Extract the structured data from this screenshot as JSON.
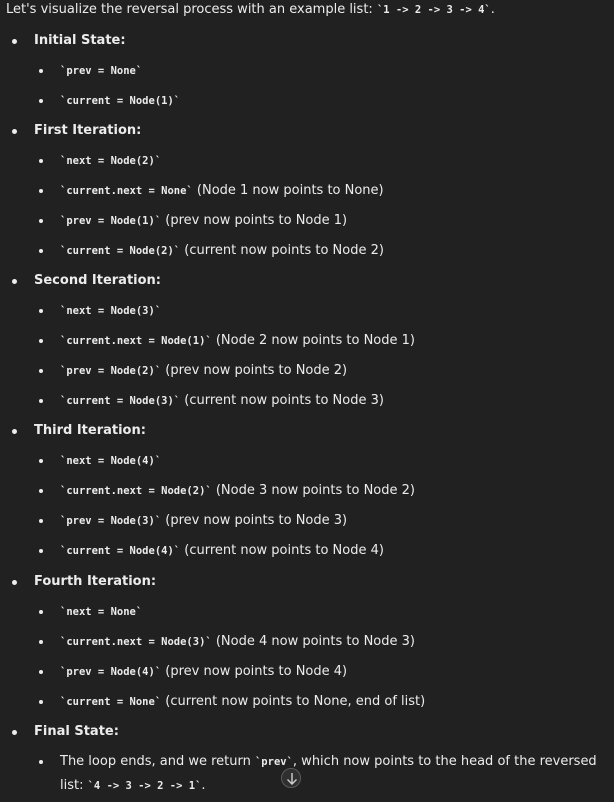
{
  "intro": {
    "prefix": "Let's visualize the reversal process with an example list: ",
    "code": "`1 -> 2 -> 3 -> 4`",
    "suffix": "."
  },
  "sections": [
    {
      "heading": "Initial State:",
      "items": [
        {
          "code": "`prev = None`",
          "text": ""
        },
        {
          "code": "`current = Node(1)`",
          "text": ""
        }
      ]
    },
    {
      "heading": "First Iteration:",
      "items": [
        {
          "code": "`next = Node(2)`",
          "text": ""
        },
        {
          "code": "`current.next = None`",
          "text": " (Node 1 now points to None)"
        },
        {
          "code": "`prev = Node(1)`",
          "text": " (prev now points to Node 1)"
        },
        {
          "code": "`current = Node(2)`",
          "text": " (current now points to Node 2)"
        }
      ]
    },
    {
      "heading": "Second Iteration:",
      "items": [
        {
          "code": "`next = Node(3)`",
          "text": ""
        },
        {
          "code": "`current.next = Node(1)`",
          "text": " (Node 2 now points to Node 1)"
        },
        {
          "code": "`prev = Node(2)`",
          "text": " (prev now points to Node 2)"
        },
        {
          "code": "`current = Node(3)`",
          "text": " (current now points to Node 3)"
        }
      ]
    },
    {
      "heading": "Third Iteration:",
      "items": [
        {
          "code": "`next = Node(4)`",
          "text": ""
        },
        {
          "code": "`current.next = Node(2)`",
          "text": " (Node 3 now points to Node 2)"
        },
        {
          "code": "`prev = Node(3)`",
          "text": " (prev now points to Node 3)"
        },
        {
          "code": "`current = Node(4)`",
          "text": " (current now points to Node 4)"
        }
      ]
    },
    {
      "heading": "Fourth Iteration:",
      "items": [
        {
          "code": "`next = None`",
          "text": ""
        },
        {
          "code": "`current.next = Node(3)`",
          "text": " (Node 4 now points to Node 3)"
        },
        {
          "code": "`prev = Node(4)`",
          "text": " (prev now points to Node 4)"
        },
        {
          "code": "`current = None`",
          "text": " (current now points to None, end of list)"
        }
      ]
    },
    {
      "heading": "Final State:",
      "items": [
        {
          "text_before": "The loop ends, and we return ",
          "code": "`prev`",
          "text_after": ", which now points to the head of the reversed list: ",
          "code2": "`4 -> 3 -> 2 -> 1`",
          "text_end": "."
        }
      ]
    }
  ],
  "scroll_button": {
    "icon": "arrow-down-icon"
  }
}
